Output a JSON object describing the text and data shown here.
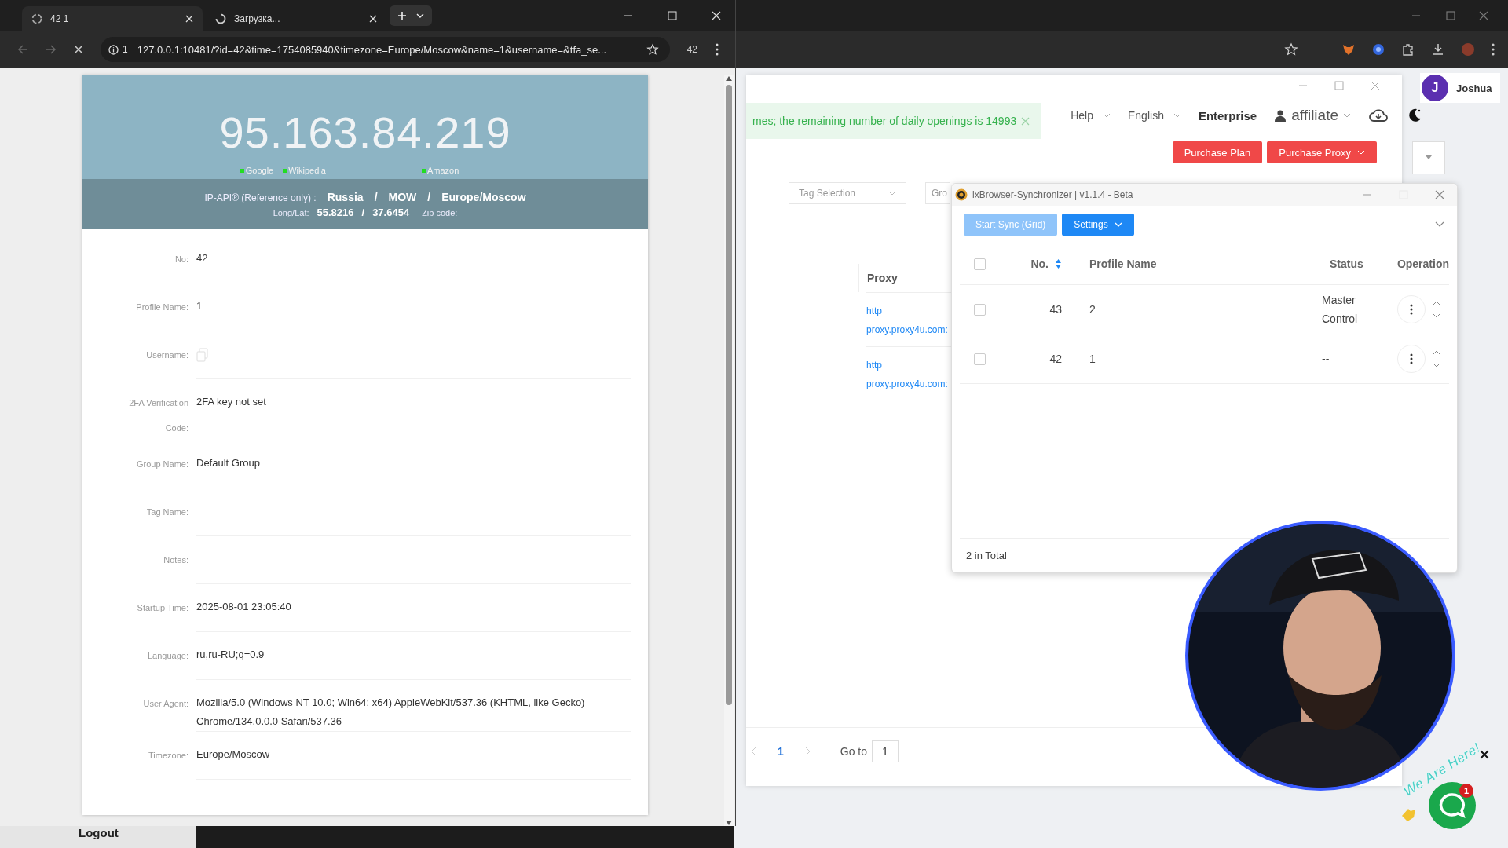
{
  "front_browser": {
    "tabs": [
      {
        "title": "42 1",
        "selected": true,
        "loading": false
      },
      {
        "title": "Загрузка...",
        "selected": false,
        "loading": true
      }
    ],
    "address": "127.0.0.1:10481/?id=42&time=1754085940&timezone=Europe/Moscow&name=1&username=&tfa_se...",
    "site_info": "1",
    "extension_badge": "42",
    "ip_card": {
      "ip": "95.163.84.219",
      "checks": [
        {
          "label": "Google",
          "color": "#22dd22"
        },
        {
          "label": "Wikipedia",
          "color": "#22dd22"
        },
        {
          "label": "Amazon",
          "color": "#22dd22"
        }
      ],
      "separator": "/",
      "source": "IP-API®  (Reference only)  :",
      "country": "Russia",
      "region": "MOW",
      "timezone": "Europe/Moscow",
      "longlat_label": "Long/Lat:",
      "lat": "55.8216",
      "lon": "37.6454",
      "zip_label": "Zip code:"
    },
    "fields": [
      {
        "kind": "text",
        "label": "No:",
        "value": "42"
      },
      {
        "kind": "text",
        "label": "Profile Name:",
        "value": "1"
      },
      {
        "kind": "icon",
        "label": "Username:"
      },
      {
        "kind": "text",
        "label": "2FA Verification Code:",
        "value": "2FA key not set"
      },
      {
        "kind": "text",
        "label": "Group Name:",
        "value": "Default Group"
      },
      {
        "kind": "text",
        "label": "Tag Name:"
      },
      {
        "kind": "text",
        "label": "Notes:"
      },
      {
        "kind": "text",
        "label": "Startup Time:",
        "value": "2025-08-01 23:05:40"
      },
      {
        "kind": "text",
        "label": "Language:",
        "value": "ru,ru-RU;q=0.9"
      },
      {
        "kind": "text",
        "label": "User Agent:",
        "value": "Mozilla/5.0 (Windows NT 10.0; Win64; x64) AppleWebKit/537.36 (KHTML, like Gecko) Chrome/134.0.0.0 Safari/537.36"
      },
      {
        "kind": "text",
        "label": "Timezone:",
        "value": "Europe/Moscow"
      }
    ]
  },
  "back_app": {
    "user": {
      "initial": "J",
      "name": "Joshua"
    },
    "notice": "mes; the remaining number of daily openings is 14993",
    "menus": [
      "Help",
      "English"
    ],
    "enterprise": "Enterprise",
    "account": "affiliate",
    "buttons": [
      "Purchase Plan",
      "Purchase Proxy"
    ],
    "filters": [
      "Tag Selection",
      "Gro"
    ],
    "proxy_header": "Proxy",
    "proxy_rows": [
      {
        "type": "http",
        "host": "proxy.proxy4u.com:"
      },
      {
        "type": "http",
        "host": "proxy.proxy4u.com:"
      }
    ],
    "pagination": {
      "page": "1",
      "goto_label": "Go to",
      "goto_value": "1"
    },
    "logout": "Logout"
  },
  "synchronizer": {
    "title": "ixBrowser-Synchronizer | v1.1.4 - Beta",
    "start": {
      "label": "Start Sync (Grid)",
      "disabled": true
    },
    "settings": "Settings",
    "columns": [
      "No.",
      "Profile Name",
      "Status",
      "Operation"
    ],
    "all_checked": false,
    "rows": [
      {
        "no": "43",
        "name": "2",
        "status": "Master Control",
        "checked": false
      },
      {
        "no": "42",
        "name": "1",
        "status": "--",
        "checked": false
      }
    ],
    "total": "2 in Total"
  },
  "chat": {
    "tagline": "We Are Here!",
    "badge": "1"
  }
}
